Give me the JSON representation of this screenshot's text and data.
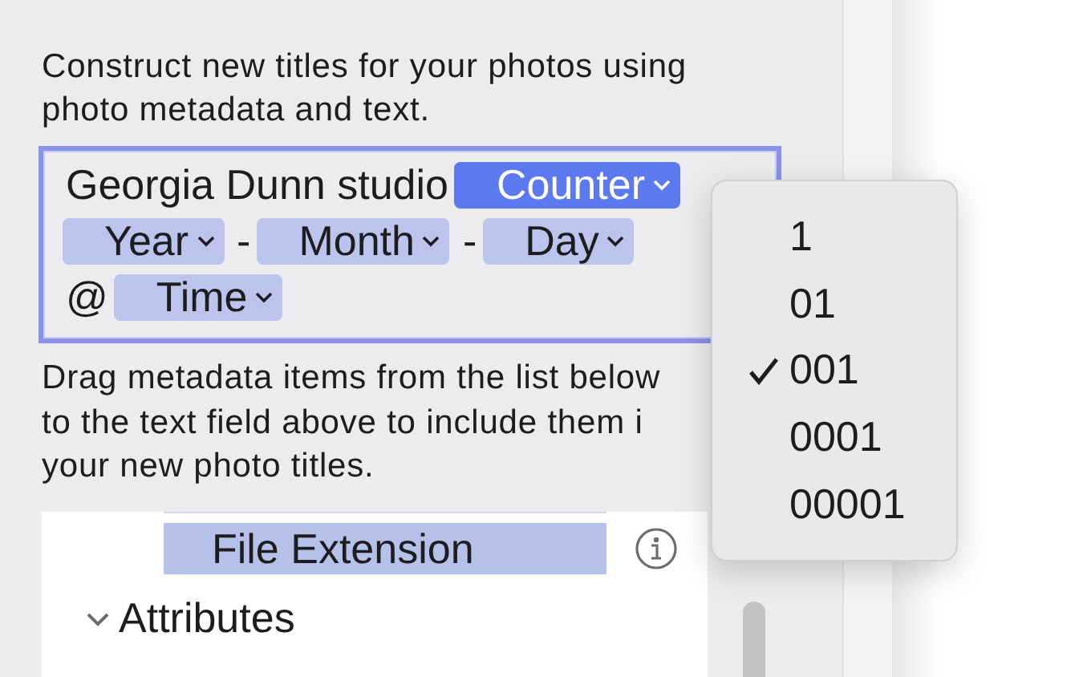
{
  "description": "Construct new titles for your photos using photo metadata and text.",
  "title_field": {
    "parts": [
      {
        "kind": "text",
        "label": "Georgia Dunn studio"
      },
      {
        "kind": "token",
        "label": "Counter",
        "selected": true
      },
      {
        "kind": "break"
      },
      {
        "kind": "token",
        "label": "Year",
        "selected": false
      },
      {
        "kind": "text",
        "label": "-"
      },
      {
        "kind": "token",
        "label": "Month",
        "selected": false
      },
      {
        "kind": "text",
        "label": "-"
      },
      {
        "kind": "token",
        "label": "Day",
        "selected": false
      },
      {
        "kind": "break"
      },
      {
        "kind": "text",
        "label": "@"
      },
      {
        "kind": "token",
        "label": "Time",
        "selected": false
      }
    ]
  },
  "help_lines": [
    "Drag metadata items from the list below",
    "to the text field above to include them i",
    "your new photo titles."
  ],
  "metadata_list": [
    {
      "kind": "item",
      "label": "File Extension",
      "selected": true
    },
    {
      "kind": "group",
      "label": "Attributes",
      "expanded": true
    }
  ],
  "counter_menu": [
    {
      "label": "1",
      "checked": false
    },
    {
      "label": "01",
      "checked": false
    },
    {
      "label": "001",
      "checked": true
    },
    {
      "label": "0001",
      "checked": false
    },
    {
      "label": "00001",
      "checked": false
    }
  ]
}
